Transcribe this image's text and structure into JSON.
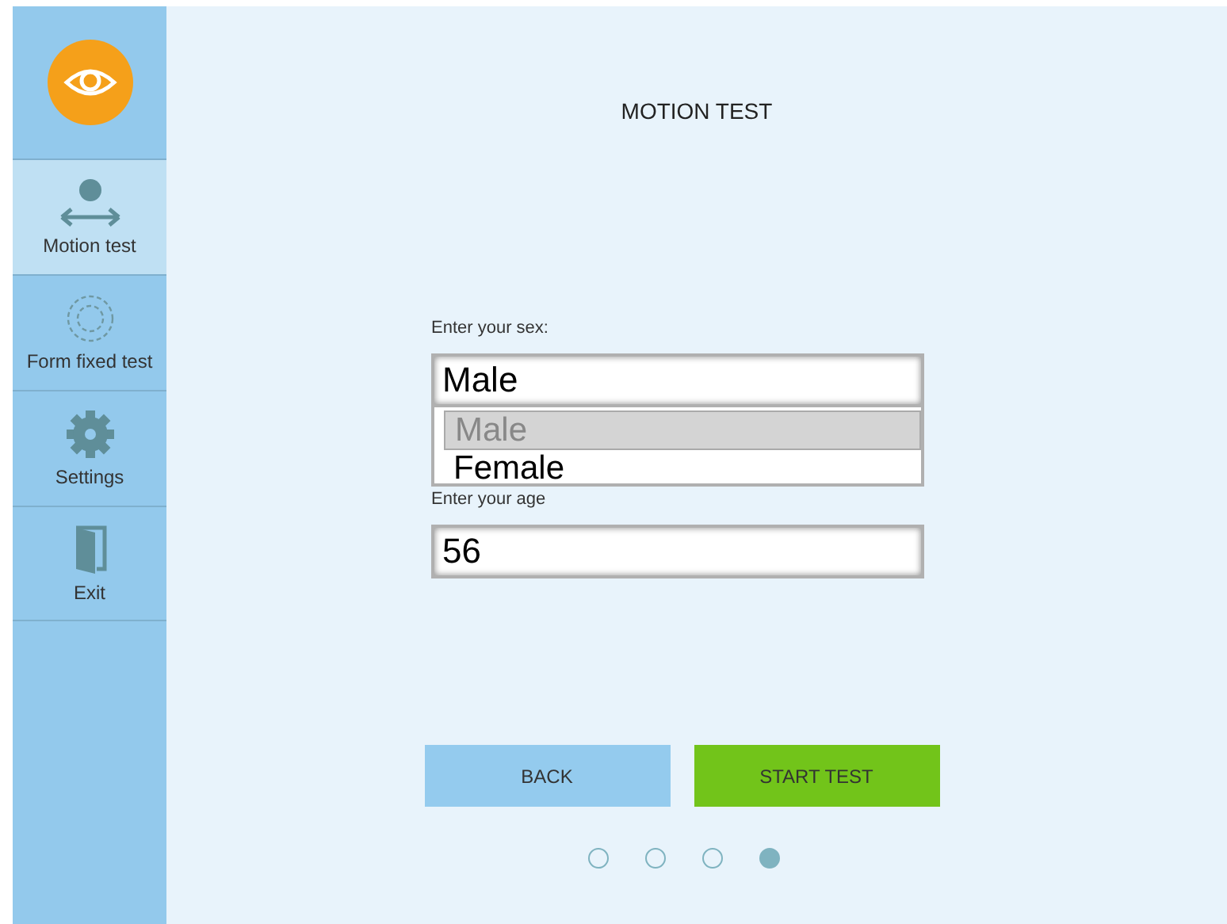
{
  "sidebar": {
    "items": [
      {
        "kind": "motion",
        "label": "Motion test",
        "selected": true
      },
      {
        "kind": "form",
        "label": "Form fixed test",
        "selected": false
      },
      {
        "kind": "settings",
        "label": "Settings",
        "selected": false
      },
      {
        "kind": "exit",
        "label": "Exit",
        "selected": false
      }
    ]
  },
  "title": "MOTION TEST",
  "sex": {
    "label": "Enter your sex:",
    "value": "Male",
    "options": [
      {
        "label": "Male",
        "selected": true
      },
      {
        "label": "Female",
        "selected": false
      }
    ]
  },
  "age": {
    "label": "Enter your age",
    "value": "56"
  },
  "buttons": [
    {
      "kind": "secondary",
      "label": "BACK"
    },
    {
      "kind": "primary",
      "label": "START TEST"
    }
  ],
  "pager": [
    {
      "selected": false
    },
    {
      "selected": false
    },
    {
      "selected": false
    },
    {
      "selected": true
    }
  ]
}
